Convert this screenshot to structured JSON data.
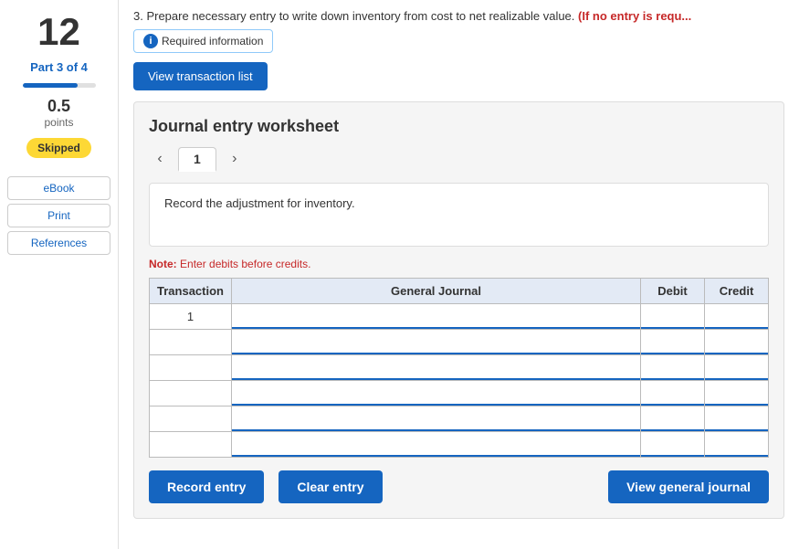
{
  "sidebar": {
    "step_number": "12",
    "part_label": "Part 3 of 4",
    "progress_percent": 75,
    "points_value": "0.5",
    "points_label": "points",
    "skipped_label": "Skipped",
    "links": [
      {
        "label": "eBook",
        "name": "ebook-link"
      },
      {
        "label": "Print",
        "name": "print-link"
      },
      {
        "label": "References",
        "name": "references-link"
      }
    ]
  },
  "header": {
    "instruction": "3. Prepare necessary entry to write down inventory from cost to net realizable value.",
    "red_text": "(If no entry is requ...",
    "required_info_label": "Required information",
    "info_icon": "i",
    "view_transaction_label": "View transaction list"
  },
  "worksheet": {
    "title": "Journal entry worksheet",
    "active_tab": "1",
    "nav_prev": "‹",
    "nav_next": "›",
    "description": "Record the adjustment for inventory.",
    "note_label": "Note:",
    "note_text": "Enter debits before credits.",
    "table": {
      "headers": [
        "Transaction",
        "General Journal",
        "Debit",
        "Credit"
      ],
      "rows": [
        {
          "tx": "1",
          "journal": "",
          "debit": "",
          "credit": ""
        },
        {
          "tx": "",
          "journal": "",
          "debit": "",
          "credit": ""
        },
        {
          "tx": "",
          "journal": "",
          "debit": "",
          "credit": ""
        },
        {
          "tx": "",
          "journal": "",
          "debit": "",
          "credit": ""
        },
        {
          "tx": "",
          "journal": "",
          "debit": "",
          "credit": ""
        },
        {
          "tx": "",
          "journal": "",
          "debit": "",
          "credit": ""
        }
      ]
    }
  },
  "actions": {
    "record_entry_label": "Record entry",
    "clear_entry_label": "Clear entry",
    "view_general_journal_label": "View general journal"
  }
}
